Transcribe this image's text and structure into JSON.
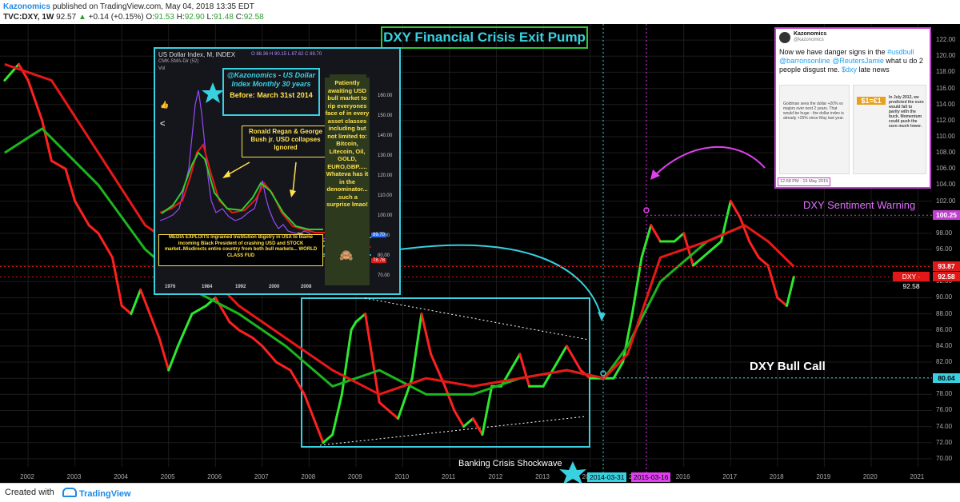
{
  "header": {
    "author": "Kazonomics",
    "published_text": "published on TradingView.com, May 04, 2018 13:35 EDT",
    "symbol": "TVC:DXY, 1W",
    "last": "92.57",
    "change": "+0.14 (+0.15%)",
    "o_label": "O:",
    "o_value": "91.53",
    "h_label": "H:",
    "h_value": "92.90",
    "l_label": "L:",
    "l_value": "91.48",
    "c_label": "C:",
    "c_value": "92.58"
  },
  "footer": {
    "created_with": "Created with",
    "brand": "TradingView"
  },
  "annotations": {
    "main_title": "DXY Financial Crisis Exit Pump",
    "sentiment_warning": "DXY Sentiment Warning",
    "bull_call": "DXY Bull Call",
    "shockwave": "Banking Crisis Shockwave"
  },
  "inset": {
    "title": "US Dollar Index, M, INDEX",
    "stats": "O 88.36 H 90.15 L 87.62 C 89.70",
    "sub1": "CMK-SMA-Dir (52)",
    "sub2": "Vol",
    "badge_title": "@Kazonomics - US Dollar Index Monthly 30 years",
    "badge_date": "Before: March 31st 2014",
    "regan_note": "Ronald Regan & George Bush jr. USD collapses Ignored",
    "side_note": "Patiently awaiting USD bull market to rip everyones face of in every asset classes including but not limited to: Bitcoin, Litecoin, Oil, GOLD, EURO,GBP..... Whateva has it in the denominator... .such a surprise lmao!",
    "media_note": "MEDIA EXPLOITS Ingrained Institution Bigotry in USA to blame incoming Black President of crashing USD and STOCK market..Misdirects entire country from both bull markets... WORLD CLASS FUD",
    "x_labels": [
      "1976",
      "1984",
      "1992",
      "2000",
      "2008"
    ],
    "y_labels": [
      "160.00",
      "150.00",
      "140.00",
      "130.00",
      "120.00",
      "110.00",
      "100.00",
      "90.00",
      "80.00",
      "70.00"
    ],
    "price_tags": [
      {
        "label": "89.70",
        "color": "#2a6df0"
      },
      {
        "label": "78.78",
        "color": "#e01818"
      }
    ]
  },
  "tweet": {
    "name": "Kazonomics",
    "handle": "@kazonomics",
    "text_parts": [
      {
        "t": "Now we have danger signs in the ",
        "c": "plain"
      },
      {
        "t": "#usdbull",
        "c": "link"
      },
      {
        "t": " ",
        "c": "plain"
      },
      {
        "t": "@barronsonline",
        "c": "link"
      },
      {
        "t": " ",
        "c": "plain"
      },
      {
        "t": "@ReutersJamie",
        "c": "link"
      },
      {
        "t": " what u do 2 people disgust me. ",
        "c": "plain"
      },
      {
        "t": "$dxy",
        "c": "link"
      },
      {
        "t": " late news",
        "c": "plain"
      }
    ],
    "img1_text": "Goldman sees the dollar +20% vs majors over next 2 years. That would be huge - the dollar index is already +25% since May last year.",
    "img2_text": "In July 2012, we predicted the euro would fall to parity with the buck. Momentum could push the euro much lower.",
    "img2_big": "$1=€1",
    "time": "12:58 PM - 15 May 2015"
  },
  "price_tags": [
    {
      "label": "100.25",
      "color": "#c040d0",
      "price": 100.25
    },
    {
      "label": "93.87",
      "color": "#e01818",
      "price": 93.87
    },
    {
      "label": "92.58",
      "color": "#e01818",
      "price": 92.58
    },
    {
      "label": "80.04",
      "color": "#39d0e0",
      "price": 80.04
    }
  ],
  "dxy_tag": "DXY · 92.58",
  "date_tags": [
    {
      "label": "2014-03-31",
      "color": "#39d0e0"
    },
    {
      "label": "2015-03-16",
      "color": "#e040f0"
    }
  ],
  "chart_data": {
    "type": "line",
    "title": "DXY Financial Crisis Exit Pump",
    "xlabel": "",
    "ylabel": "",
    "x_ticks": [
      "2002",
      "2003",
      "2004",
      "2005",
      "2006",
      "2007",
      "2008",
      "2009",
      "2010",
      "2011",
      "2012",
      "2013",
      "2014",
      "2015",
      "2016",
      "2017",
      "2018",
      "2019",
      "2020",
      "2021"
    ],
    "y_ticks": [
      70,
      72,
      74,
      76,
      78,
      80,
      82,
      84,
      86,
      88,
      90,
      92,
      94,
      96,
      98,
      100,
      102,
      104,
      106,
      108,
      110,
      112,
      114,
      116,
      118,
      120,
      122
    ],
    "ylim": [
      69,
      124
    ],
    "xlim": [
      2001.4,
      2021.3
    ],
    "grid": true,
    "series": [
      {
        "name": "DXY weekly",
        "color_up": "#2ee82e",
        "color_down": "#ff2020",
        "x": [
          2001.5,
          2001.8,
          2002.0,
          2002.3,
          2002.5,
          2002.8,
          2003.0,
          2003.3,
          2003.5,
          2003.8,
          2004.0,
          2004.2,
          2004.4,
          2004.6,
          2004.8,
          2005.0,
          2005.2,
          2005.5,
          2005.8,
          2006.0,
          2006.3,
          2006.5,
          2006.8,
          2007.0,
          2007.3,
          2007.6,
          2007.9,
          2008.1,
          2008.3,
          2008.5,
          2008.7,
          2008.9,
          2009.0,
          2009.2,
          2009.5,
          2009.7,
          2009.9,
          2010.2,
          2010.4,
          2010.6,
          2010.9,
          2011.1,
          2011.3,
          2011.5,
          2011.7,
          2011.9,
          2012.1,
          2012.3,
          2012.5,
          2012.7,
          2013.0,
          2013.3,
          2013.5,
          2013.8,
          2014.0,
          2014.3,
          2014.5,
          2014.7,
          2014.9,
          2015.1,
          2015.3,
          2015.5,
          2015.8,
          2016.0,
          2016.2,
          2016.4,
          2016.6,
          2016.8,
          2017.0,
          2017.2,
          2017.4,
          2017.6,
          2017.8,
          2018.0,
          2018.2,
          2018.35
        ],
        "y": [
          117,
          119,
          117,
          112,
          107,
          106,
          102,
          99,
          98,
          95,
          89,
          88,
          91,
          88,
          85,
          81,
          84,
          88,
          89,
          90,
          87,
          86,
          85,
          84,
          82,
          81,
          78,
          75,
          72,
          73,
          78,
          86,
          87,
          88,
          77,
          76,
          75,
          80,
          88,
          83,
          79,
          76,
          74,
          75,
          73,
          79,
          79,
          81,
          83,
          79,
          79,
          82,
          84,
          81,
          80,
          80,
          80,
          82,
          88,
          95,
          99,
          97,
          97,
          98,
          94,
          95,
          96,
          97,
          102,
          100,
          97,
          95,
          94,
          90,
          89,
          92.58
        ]
      },
      {
        "name": "MA",
        "color": "#e81818",
        "x": [
          2001.5,
          2002.5,
          2003.5,
          2004.5,
          2005.5,
          2006.5,
          2007.5,
          2008.5,
          2009.5,
          2010.5,
          2011.5,
          2012.5,
          2013.5,
          2014.3,
          2014.8,
          2015.5,
          2016.5,
          2017.3,
          2017.8,
          2018.35
        ],
        "y": [
          119,
          117,
          108,
          99,
          95,
          89,
          85,
          81,
          78,
          80,
          79,
          80,
          81,
          80,
          83,
          95,
          97,
          99,
          97,
          93.87
        ]
      },
      {
        "name": "Trend MA",
        "color": "#1eb41e",
        "x": [
          2001.5,
          2002.3,
          2003.5,
          2004.5,
          2005.5,
          2006.5,
          2007.5,
          2008.5,
          2009.5,
          2010.5,
          2011.5,
          2012.5,
          2013.5,
          2014.3,
          2014.8,
          2015.5,
          2016.5,
          2017.3
        ],
        "y": [
          108,
          111,
          104,
          96,
          91,
          88,
          84,
          79,
          81,
          78,
          78,
          80,
          81,
          80,
          84,
          92,
          97,
          99
        ]
      }
    ]
  }
}
